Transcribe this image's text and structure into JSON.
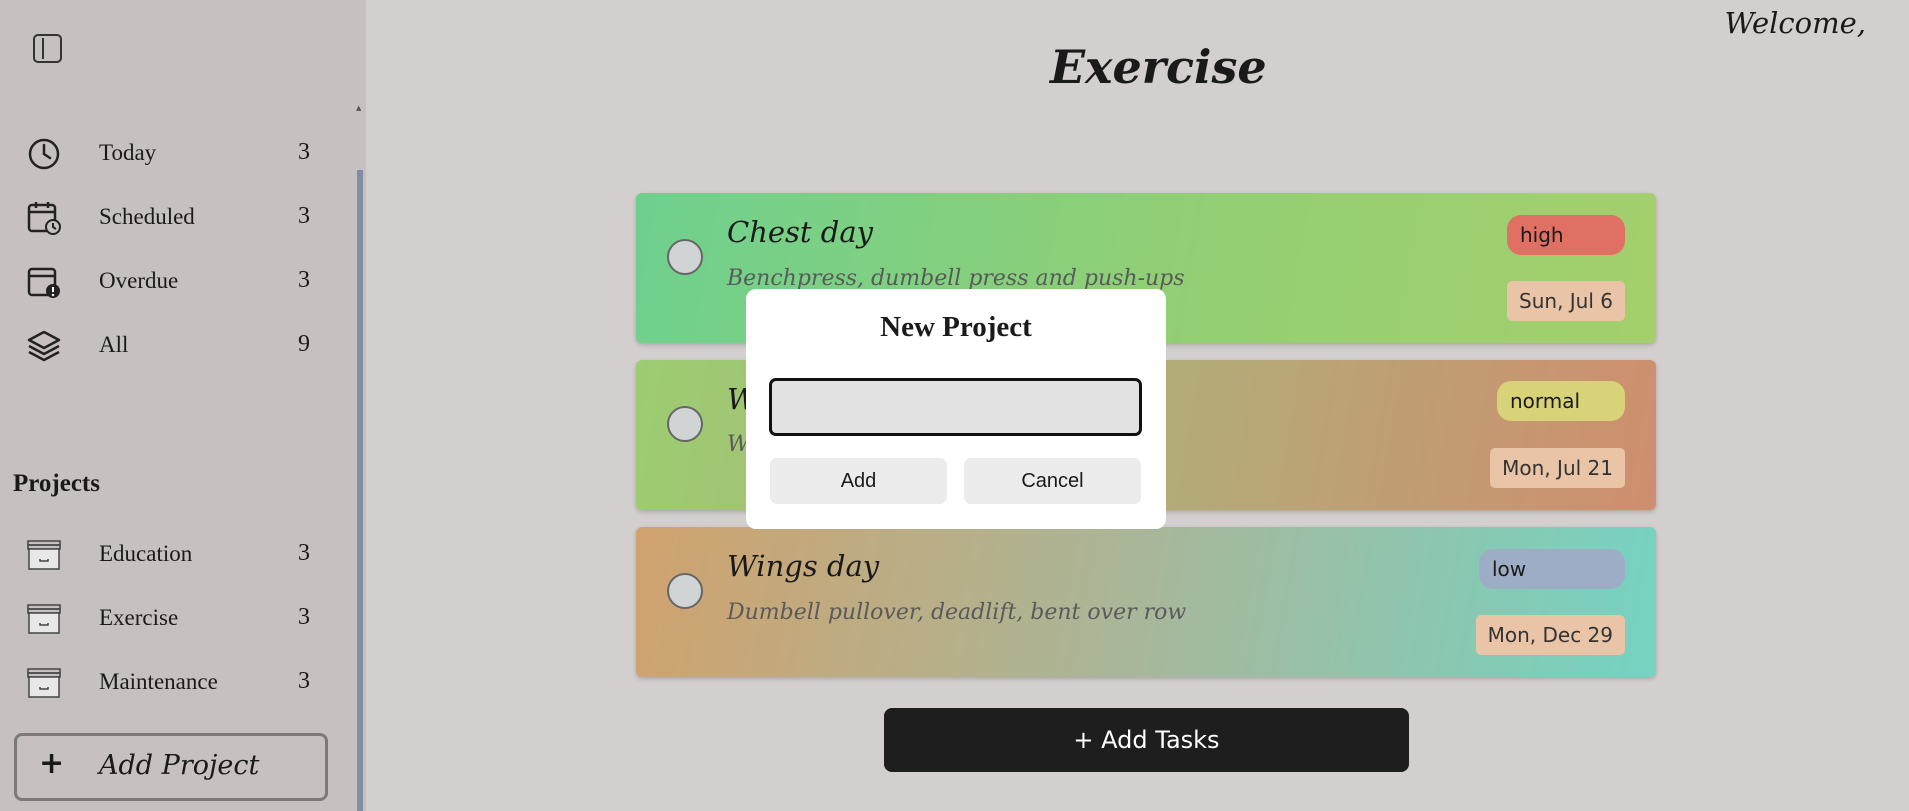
{
  "sidebar": {
    "toggle_icon": "sidebar-toggle-icon",
    "filters": [
      {
        "label": "Today",
        "count": "3",
        "icon": "clock-icon"
      },
      {
        "label": "Scheduled",
        "count": "3",
        "icon": "calendar-clock-icon"
      },
      {
        "label": "Overdue",
        "count": "3",
        "icon": "calendar-alert-icon"
      },
      {
        "label": "All",
        "count": "9",
        "icon": "layers-icon"
      }
    ],
    "projects_heading": "Projects",
    "projects": [
      {
        "label": "Education",
        "count": "3",
        "icon": "archive-icon"
      },
      {
        "label": "Exercise",
        "count": "3",
        "icon": "archive-icon"
      },
      {
        "label": "Maintenance",
        "count": "3",
        "icon": "archive-icon"
      }
    ],
    "add_project": {
      "icon": "+",
      "label": "Add Project"
    }
  },
  "header": {
    "welcome": "Welcome,",
    "title": "Exercise"
  },
  "tasks": [
    {
      "title": "Chest day",
      "desc": "Benchpress, dumbell press and push-ups",
      "priority": "high",
      "date": "Sun, Jul 6",
      "priority_color": "#e07064"
    },
    {
      "title": "W",
      "desc": "W                                              ast 5 m",
      "priority": "normal",
      "date": "Mon, Jul 21",
      "priority_color": "#d8d278"
    },
    {
      "title": "Wings day",
      "desc": "Dumbell pullover, deadlift, bent over row",
      "priority": "low",
      "date": "Mon, Dec 29",
      "priority_color": "#9eadc6"
    }
  ],
  "add_tasks_label": "+ Add Tasks",
  "modal": {
    "title": "New Project",
    "input_value": "",
    "add_label": "Add",
    "cancel_label": "Cancel"
  }
}
